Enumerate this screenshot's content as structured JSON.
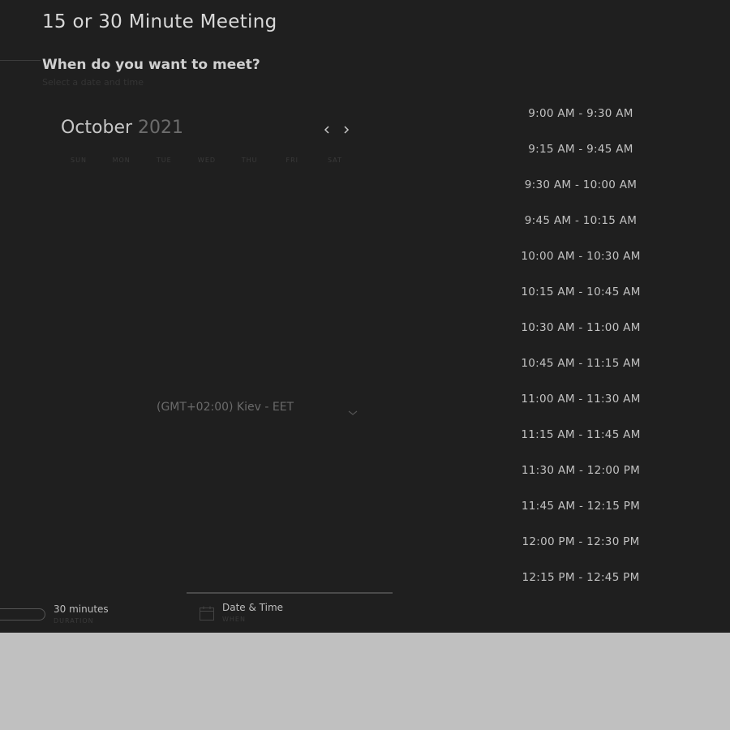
{
  "meeting": {
    "title": "15 or 30 Minute Meeting"
  },
  "prompt": {
    "question": "When do you want to meet?",
    "subtext": "Select a date and time"
  },
  "calendar": {
    "month": "October",
    "year": "2021",
    "weekdays": [
      "SUN",
      "MON",
      "TUE",
      "WED",
      "THU",
      "FRI",
      "SAT"
    ],
    "prev_icon": "chevron-left-icon",
    "next_icon": "chevron-right-icon"
  },
  "timezone": {
    "value": "(GMT+02:00) Kiev - EET",
    "icon": "chevron-down-icon"
  },
  "time_slots": [
    "9:00 AM - 9:30 AM",
    "9:15 AM - 9:45 AM",
    "9:30 AM - 10:00 AM",
    "9:45 AM - 10:15 AM",
    "10:00 AM - 10:30 AM",
    "10:15 AM - 10:45 AM",
    "10:30 AM - 11:00 AM",
    "10:45 AM - 11:15 AM",
    "11:00 AM - 11:30 AM",
    "11:15 AM - 11:45 AM",
    "11:30 AM - 12:00 PM",
    "11:45 AM - 12:15 PM",
    "12:00 PM - 12:30 PM",
    "12:15 PM - 12:45 PM"
  ],
  "steps": {
    "duration": {
      "label": "30 minutes",
      "sub": "DURATION"
    },
    "date_time": {
      "label": "Date & Time",
      "sub": "WHEN",
      "icon": "calendar-icon"
    }
  },
  "colors": {
    "panel_bg": "#1f1f1f",
    "page_bg": "#c0c0c0",
    "text_primary": "#c2c2c2",
    "text_muted": "#6a6a6a"
  }
}
